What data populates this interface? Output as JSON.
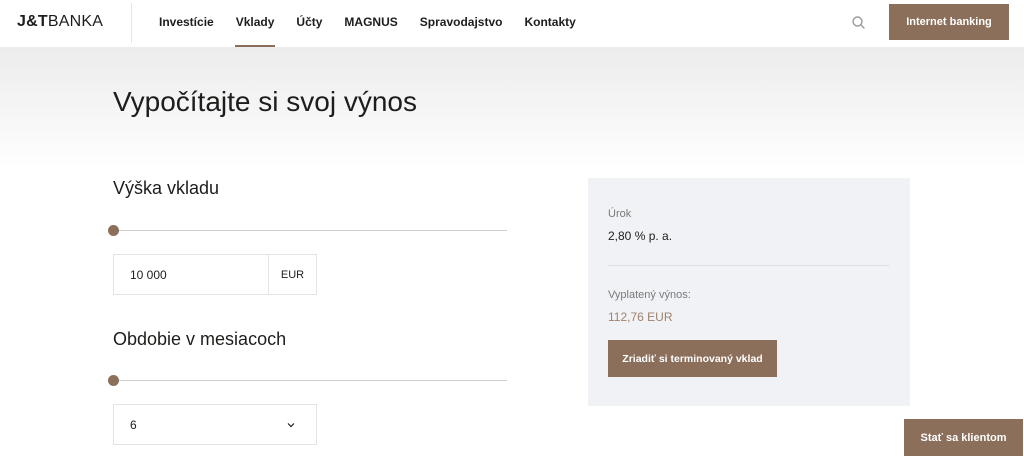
{
  "header": {
    "logo_bold": "J&T",
    "logo_light": "BANKA",
    "nav": [
      {
        "label": "Investície",
        "active": false
      },
      {
        "label": "Vklady",
        "active": true
      },
      {
        "label": "Účty",
        "active": false
      },
      {
        "label": "MAGNUS",
        "active": false
      },
      {
        "label": "Spravodajstvo",
        "active": false
      },
      {
        "label": "Kontakty",
        "active": false
      }
    ],
    "search_icon": "search-icon",
    "internet_banking_label": "Internet banking"
  },
  "page": {
    "title": "Vypočítajte si svoj výnos"
  },
  "calculator": {
    "amount_label": "Výška vkladu",
    "amount_slider_level": 0,
    "amount_value": "10 000",
    "amount_unit": "EUR",
    "period_label": "Obdobie v mesiacoch",
    "period_slider_level": 0,
    "period_value": "6",
    "period_icon": "chevron-down-icon"
  },
  "result": {
    "rate_label": "Úrok",
    "rate_value": "2,80 % p. a.",
    "yield_label": "Vyplatený výnos:",
    "yield_value": "112,76 EUR",
    "cta_label": "Zriadiť si terminovaný vklad"
  },
  "floating": {
    "become_client_label": "Stať sa klientom"
  },
  "colors": {
    "accent": "#8b6f5a",
    "panel_bg": "#f1f2f6",
    "yield_text": "#a0826d",
    "text": "#1d1d1b"
  }
}
